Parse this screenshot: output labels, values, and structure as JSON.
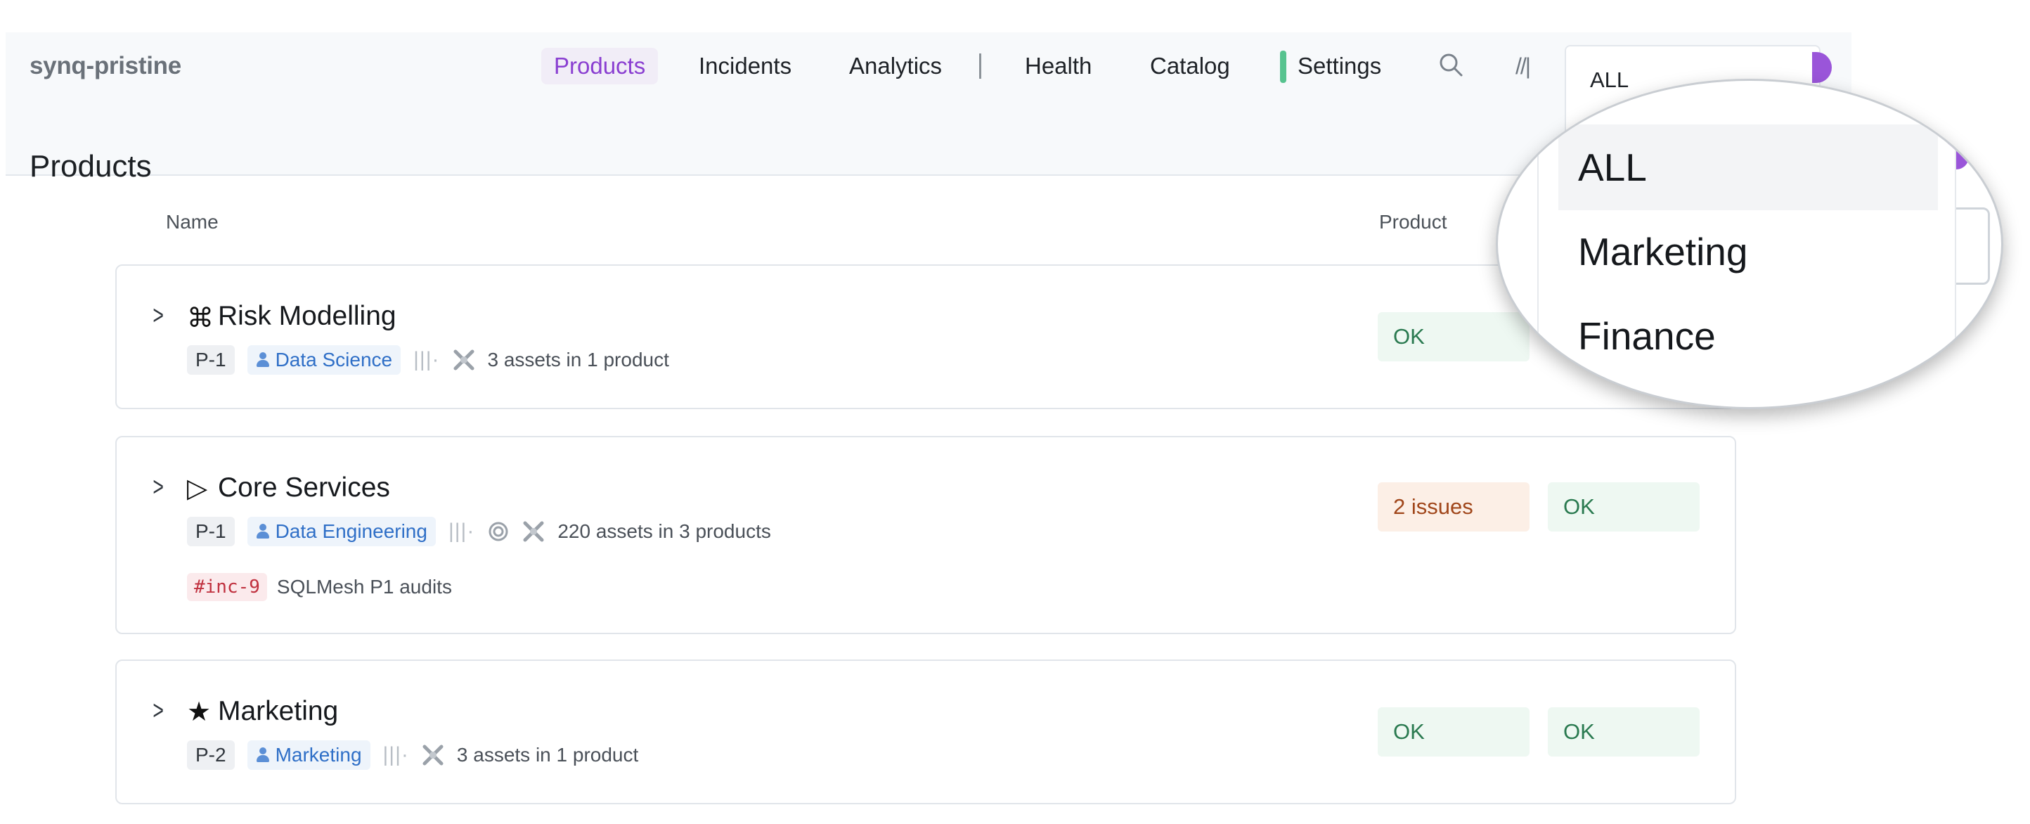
{
  "app": {
    "brand": "synq-pristine"
  },
  "nav": {
    "items": [
      {
        "label": "Products",
        "active": true
      },
      {
        "label": "Incidents"
      },
      {
        "label": "Analytics"
      },
      {
        "label": "Health"
      },
      {
        "label": "Catalog"
      },
      {
        "label": "Settings"
      }
    ],
    "shortcut_hint": "//|",
    "domain_select_value": "ALL"
  },
  "page": {
    "title": "Products"
  },
  "table": {
    "columns": [
      "Name",
      "Product"
    ],
    "rows": [
      {
        "icon": "⌘",
        "name": "Risk Modelling",
        "priority": "P-1",
        "owner": "Data Science",
        "assets": "3 assets in 1 product",
        "statuses": [
          "OK"
        ]
      },
      {
        "icon": "▷",
        "name": "Core Services",
        "priority": "P-1",
        "owner": "Data Engineering",
        "assets": "220 assets in 3 products",
        "incident_tag": "#inc-9",
        "incident_title": "SQLMesh P1 audits",
        "statuses": [
          "2 issues",
          "OK"
        ]
      },
      {
        "icon": "★",
        "name": "Marketing",
        "priority": "P-2",
        "owner": "Marketing",
        "assets": "3 assets in 1 product",
        "statuses": [
          "OK",
          "OK"
        ]
      }
    ]
  },
  "dropdown": {
    "options": [
      "ALL",
      "Marketing",
      "Finance"
    ],
    "selected": "ALL"
  },
  "colors": {
    "accent": "#8a3fd1",
    "ok": "#2a7a50",
    "warn": "#a0461a",
    "owner": "#2f6fc7",
    "incident": "#c0313f"
  }
}
